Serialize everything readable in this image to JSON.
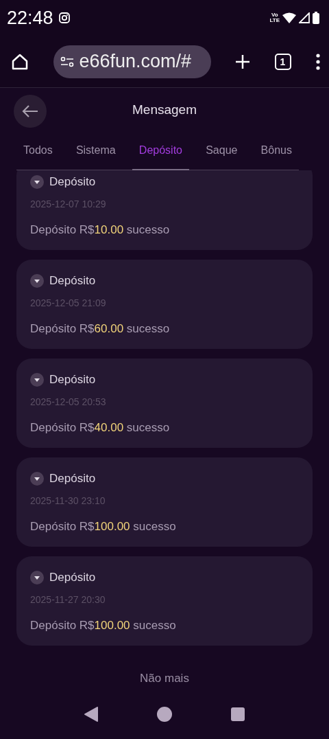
{
  "status_bar": {
    "time": "22:48",
    "volte": [
      "Vo",
      "LTE"
    ]
  },
  "browser": {
    "url": "e66fun.com/#",
    "tab_count": "1"
  },
  "header": {
    "title": "Mensagem"
  },
  "tabs": [
    {
      "label": "Todos",
      "selected": false
    },
    {
      "label": "Sistema",
      "selected": false
    },
    {
      "label": "Depósito",
      "selected": true
    },
    {
      "label": "Saque",
      "selected": false
    },
    {
      "label": "Bônus",
      "selected": false
    }
  ],
  "messages": [
    {
      "title": "Depósito",
      "date": "2025-12-07 10:29",
      "prefix": "Depósito R$",
      "amount": "10.00",
      "suffix": "sucesso",
      "expanded": false
    },
    {
      "title": "Depósito",
      "date": "2025-12-05 21:09",
      "prefix": "Depósito R$",
      "amount": "60.00",
      "suffix": "sucesso",
      "expanded": false
    },
    {
      "title": "Depósito",
      "date": "2025-12-05 20:53",
      "prefix": "Depósito R$",
      "amount": "40.00",
      "suffix": "sucesso",
      "expanded": false
    },
    {
      "title": "Depósito",
      "date": "2025-11-30 23:10",
      "prefix": "Depósito R$",
      "amount": "100.00",
      "suffix": "sucesso",
      "expanded": false
    },
    {
      "title": "Depósito",
      "date": "2025-11-27 20:30",
      "prefix": "Depósito R$",
      "amount": "100.00",
      "suffix": "sucesso",
      "expanded": false
    }
  ],
  "end_text": "Não mais"
}
